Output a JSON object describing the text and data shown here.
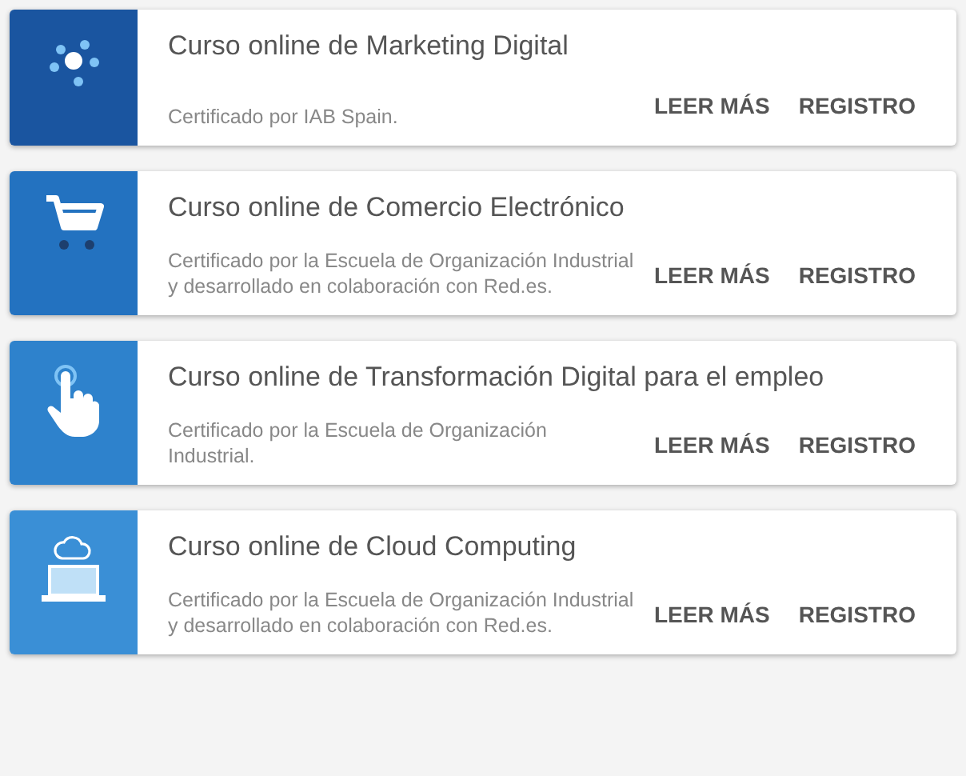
{
  "courses": [
    {
      "kind": "dots",
      "color": "#1a55a0",
      "title": "Curso online de Marketing Digital",
      "description": "Certificado por IAB Spain.",
      "buttons": [
        "LEER MÁS",
        "REGISTRO"
      ]
    },
    {
      "kind": "cart",
      "color": "#2372c0",
      "title": "Curso online de Comercio Electrónico",
      "description": "Certificado por la Escuela de Organización Industrial y desarrollado en colaboración con Red.es.",
      "buttons": [
        "LEER MÁS",
        "REGISTRO"
      ]
    },
    {
      "kind": "hand",
      "color": "#2e82cc",
      "title": "Curso online de Transformación Digital para el empleo",
      "description": "Certificado por la Escuela de Organización Industrial.",
      "buttons": [
        "LEER MÁS",
        "REGISTRO"
      ]
    },
    {
      "kind": "laptop",
      "color": "#3a8fd6",
      "title": "Curso online de Cloud Computing",
      "description": "Certificado por la Escuela de Organización Industrial y desarrollado en colaboración con Red.es.",
      "buttons": [
        "LEER MÁS",
        "REGISTRO"
      ]
    }
  ]
}
